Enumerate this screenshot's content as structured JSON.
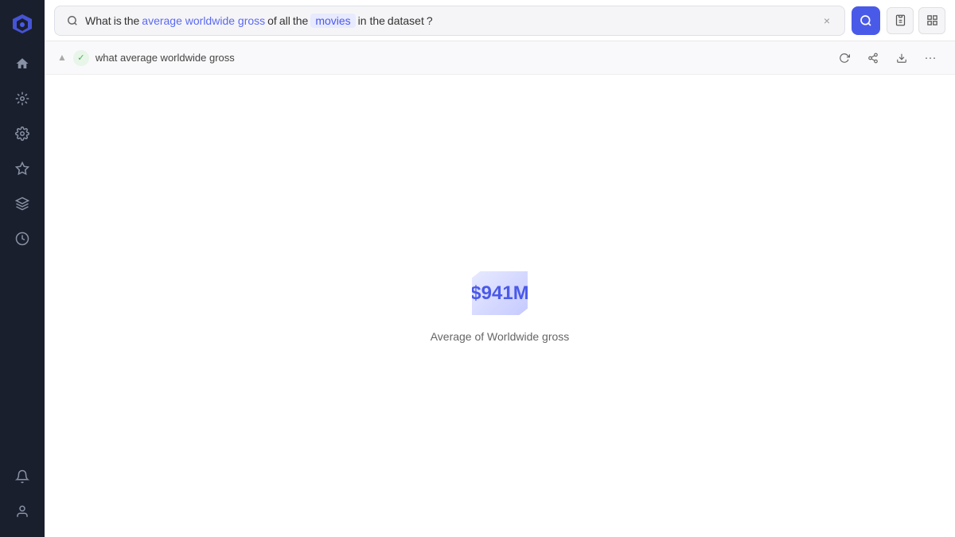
{
  "sidebar": {
    "logo_icon": "◈",
    "items": [
      {
        "id": "home",
        "icon": "⌂",
        "label": "Home",
        "active": false
      },
      {
        "id": "search",
        "icon": "◉",
        "label": "Search",
        "active": false
      },
      {
        "id": "settings",
        "icon": "✦",
        "label": "Settings",
        "active": false
      },
      {
        "id": "favorites",
        "icon": "☆",
        "label": "Favorites",
        "active": false
      },
      {
        "id": "layers",
        "icon": "⊞",
        "label": "Layers",
        "active": false
      },
      {
        "id": "history",
        "icon": "◷",
        "label": "History",
        "active": false
      }
    ],
    "bottom_items": [
      {
        "id": "notifications",
        "icon": "🔔",
        "label": "Notifications"
      },
      {
        "id": "user",
        "icon": "👤",
        "label": "User"
      }
    ]
  },
  "search_bar": {
    "query_tokens": [
      {
        "text": "What",
        "type": "plain"
      },
      {
        "text": "is",
        "type": "plain"
      },
      {
        "text": "the",
        "type": "plain"
      },
      {
        "text": "average worldwide gross",
        "type": "highlight"
      },
      {
        "text": "of",
        "type": "plain"
      },
      {
        "text": "all",
        "type": "plain"
      },
      {
        "text": "the",
        "type": "plain"
      },
      {
        "text": "movies",
        "type": "blue-bg"
      },
      {
        "text": "in the",
        "type": "plain"
      },
      {
        "text": "dataset",
        "type": "plain"
      },
      {
        "text": "?",
        "type": "plain"
      }
    ],
    "clear_label": "×",
    "toolbar_icons": [
      "📋",
      "⊞"
    ]
  },
  "subtitle": {
    "check_icon": "✓",
    "text": "what average worldwide gross",
    "action_icons": [
      "↻",
      "⤴",
      "⤷",
      "···"
    ]
  },
  "result": {
    "metric_value": "$941M",
    "metric_label": "Average of Worldwide gross"
  },
  "colors": {
    "accent": "#4a5ae8",
    "sidebar_bg": "#1a1f2e",
    "token_highlight": "#5b6af0",
    "token_blue_bg_text": "#4a5ae8",
    "token_blue_bg": "#e8eaff"
  }
}
